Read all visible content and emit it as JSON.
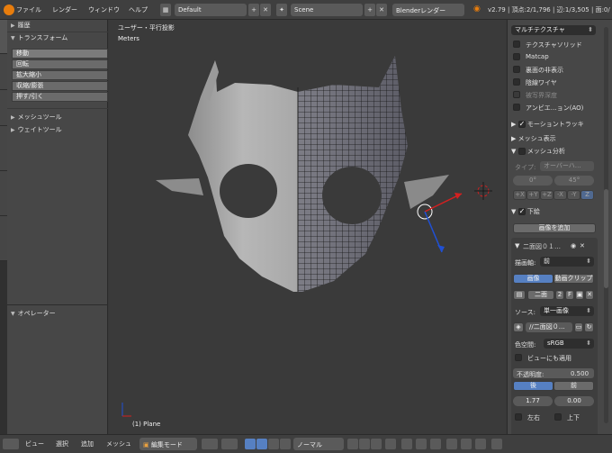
{
  "topbar": {
    "menus": [
      "ファイル",
      "レンダー",
      "ウィンドウ",
      "ヘルプ"
    ],
    "layout": "Default",
    "scene": "Scene",
    "engine": "Blenderレンダー",
    "version": "v2.79 | 頂点:2/1,796 | 辺:1/3,505 | 面:0/"
  },
  "toolshelf": {
    "history": "履歴",
    "transform": "トランスフォーム",
    "tools": [
      "移動",
      "回転",
      "拡大縮小",
      "収縮/膨張",
      "押す/引く"
    ],
    "mesh_tools": "メッシュツール",
    "weight_tools": "ウェイトツール",
    "operator": "オペレーター"
  },
  "viewport": {
    "view_name": "ユーザー・平行投影",
    "units": "Meters",
    "object": "(1) Plane"
  },
  "properties": {
    "shading_mode": "マルチテクスチャ",
    "checks": [
      {
        "label": "テクスチャソリッド",
        "on": false,
        "disabled": false
      },
      {
        "label": "Matcap",
        "on": false,
        "disabled": false
      },
      {
        "label": "裏面の非表示",
        "on": false,
        "disabled": false
      },
      {
        "label": "陰線ワイヤ",
        "on": false,
        "disabled": false
      },
      {
        "label": "被写界深度",
        "on": false,
        "disabled": true
      },
      {
        "label": "アンビエ…ョン(AO)",
        "on": false,
        "disabled": false
      }
    ],
    "motion_tracking": "モーショントラッキ",
    "mesh_display": "メッシュ表示",
    "mesh_analysis": "メッシュ分析",
    "type_label": "タイプ:",
    "type_value": "オーバーハ…",
    "angle_min": "0°",
    "angle_max": "45°",
    "axes": [
      "+X",
      "+Y",
      "+Z",
      "-X",
      "-Y",
      "Z"
    ],
    "background": "下絵",
    "add_image": "画像を追加",
    "image_name": "二面図０１…",
    "axis_label": "描画軸:",
    "axis_value": "前",
    "source_tabs": [
      "画像",
      "動画クリップ"
    ],
    "image_field": "二面",
    "image_users": "2",
    "image_f": "F",
    "source_label": "ソース:",
    "source_value": "単一画像",
    "file_path": "//二面図０…",
    "colorspace_label": "色空間:",
    "colorspace_value": "sRGB",
    "view_apply": "ビューにも適用",
    "opacity_label": "不透明度:",
    "opacity_value": "0.500",
    "back_front": [
      "後",
      "前"
    ],
    "offset_x": "1.77",
    "offset_y": "0.00",
    "flip_h": "左右",
    "flip_v": "上下"
  },
  "bottombar": {
    "menus": [
      "ビュー",
      "選択",
      "追加",
      "メッシュ"
    ],
    "mode": "編集モード",
    "orientation": "ノーマル"
  }
}
